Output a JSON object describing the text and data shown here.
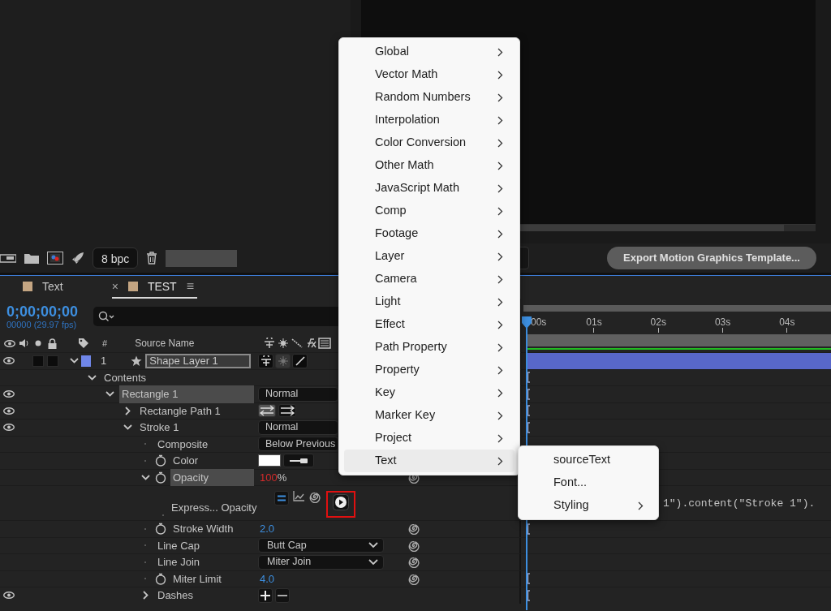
{
  "project_panel": {
    "bit_depth": "8 bpc"
  },
  "composition_viewer": {
    "export_button": "Export Motion Graphics Template..."
  },
  "timeline": {
    "tabs": [
      {
        "label": "Text",
        "selected": false
      },
      {
        "label": "TEST",
        "selected": true,
        "close": "×",
        "menu": "≡"
      }
    ],
    "current_time": "0;00;00;00",
    "frame_info": "00000 (29.97 fps)",
    "columns": {
      "number": "#",
      "source_name": "Source Name"
    },
    "ruler": [
      "00s",
      "01s",
      "02s",
      "03s",
      "04s"
    ],
    "layers": [
      {
        "kind": "layer",
        "number": "1",
        "name": "Shape Layer 1",
        "eye": true,
        "expanded": true,
        "selected": false,
        "color": "#6f86e8",
        "switches": [
          {
            "on": true
          },
          {
            "on": false
          },
          {
            "on": true
          }
        ],
        "track": {
          "kind": "layer_bar"
        },
        "children": [
          {
            "name": "Contents",
            "expanded": true,
            "selected": false,
            "track": {
              "kind": "marker"
            },
            "children": [
              {
                "name": "Rectangle 1",
                "eye": true,
                "expanded": true,
                "selected": true,
                "value": {
                  "kind": "dropdown",
                  "text": "Normal"
                },
                "track": {
                  "kind": "marker"
                },
                "children": [
                  {
                    "name": "Rectangle Path 1",
                    "eye": true,
                    "expanded": false,
                    "selected": false,
                    "value": {
                      "kind": "path_direction"
                    },
                    "track": {
                      "kind": "marker"
                    }
                  },
                  {
                    "name": "Stroke 1",
                    "eye": true,
                    "expanded": true,
                    "selected": false,
                    "value": {
                      "kind": "dropdown",
                      "text": "Normal"
                    },
                    "track": {
                      "kind": "marker"
                    },
                    "children": [
                      {
                        "name": "Composite",
                        "selected": false,
                        "value": {
                          "kind": "dropdown",
                          "text": "Below Previous"
                        }
                      },
                      {
                        "name": "Color",
                        "stopwatch": true,
                        "selected": false,
                        "value": {
                          "kind": "color",
                          "color": "#ffffff"
                        }
                      },
                      {
                        "name": "Opacity",
                        "stopwatch": true,
                        "expanded": true,
                        "selected": true,
                        "pickwhip": true,
                        "value": {
                          "kind": "percent",
                          "number": "100",
                          "unit": "%"
                        },
                        "children": [
                          {
                            "kind": "expression",
                            "name": "Express... Opacity",
                            "selected": false,
                            "value": {
                              "kind": "expression_tools"
                            },
                            "track": {
                              "kind": "expression",
                              "text": "1\").content(\"Stroke 1\")."
                            }
                          }
                        ]
                      },
                      {
                        "name": "Stroke Width",
                        "stopwatch": true,
                        "selected": false,
                        "pickwhip": true,
                        "value": {
                          "kind": "number",
                          "text": "2.0"
                        },
                        "track": {
                          "kind": "marker"
                        }
                      },
                      {
                        "name": "Line Cap",
                        "selected": false,
                        "pickwhip": true,
                        "value": {
                          "kind": "dropdown",
                          "text": "Butt Cap",
                          "caret": true
                        }
                      },
                      {
                        "name": "Line Join",
                        "selected": false,
                        "pickwhip": true,
                        "value": {
                          "kind": "dropdown",
                          "text": "Miter Join",
                          "caret": true
                        }
                      },
                      {
                        "name": "Miter Limit",
                        "stopwatch": true,
                        "selected": false,
                        "pickwhip": true,
                        "value": {
                          "kind": "number",
                          "text": "4.0"
                        },
                        "track": {
                          "kind": "marker"
                        }
                      },
                      {
                        "name": "Dashes",
                        "eye": true,
                        "expanded": false,
                        "selected": false,
                        "value": {
                          "kind": "add_remove"
                        },
                        "track": {
                          "kind": "marker"
                        }
                      }
                    ]
                  }
                ]
              }
            ]
          }
        ]
      }
    ]
  },
  "context_menu": {
    "items": [
      {
        "label": "Global",
        "submenu": true,
        "selected": false
      },
      {
        "label": "Vector Math",
        "submenu": true,
        "selected": false
      },
      {
        "label": "Random Numbers",
        "submenu": true,
        "selected": false
      },
      {
        "label": "Interpolation",
        "submenu": true,
        "selected": false
      },
      {
        "label": "Color Conversion",
        "submenu": true,
        "selected": false
      },
      {
        "label": "Other Math",
        "submenu": true,
        "selected": false
      },
      {
        "label": "JavaScript Math",
        "submenu": true,
        "selected": false
      },
      {
        "label": "Comp",
        "submenu": true,
        "selected": false
      },
      {
        "label": "Footage",
        "submenu": true,
        "selected": false
      },
      {
        "label": "Layer",
        "submenu": true,
        "selected": false
      },
      {
        "label": "Camera",
        "submenu": true,
        "selected": false
      },
      {
        "label": "Light",
        "submenu": true,
        "selected": false
      },
      {
        "label": "Effect",
        "submenu": true,
        "selected": false
      },
      {
        "label": "Path Property",
        "submenu": true,
        "selected": false
      },
      {
        "label": "Property",
        "submenu": true,
        "selected": false
      },
      {
        "label": "Key",
        "submenu": true,
        "selected": false
      },
      {
        "label": "Marker Key",
        "submenu": true,
        "selected": false
      },
      {
        "label": "Project",
        "submenu": true,
        "selected": false
      },
      {
        "label": "Text",
        "submenu": true,
        "selected": true
      }
    ]
  },
  "submenu": {
    "items": [
      {
        "label": "sourceText"
      },
      {
        "label": "Font..."
      },
      {
        "label": "Styling",
        "submenu": true
      }
    ]
  }
}
